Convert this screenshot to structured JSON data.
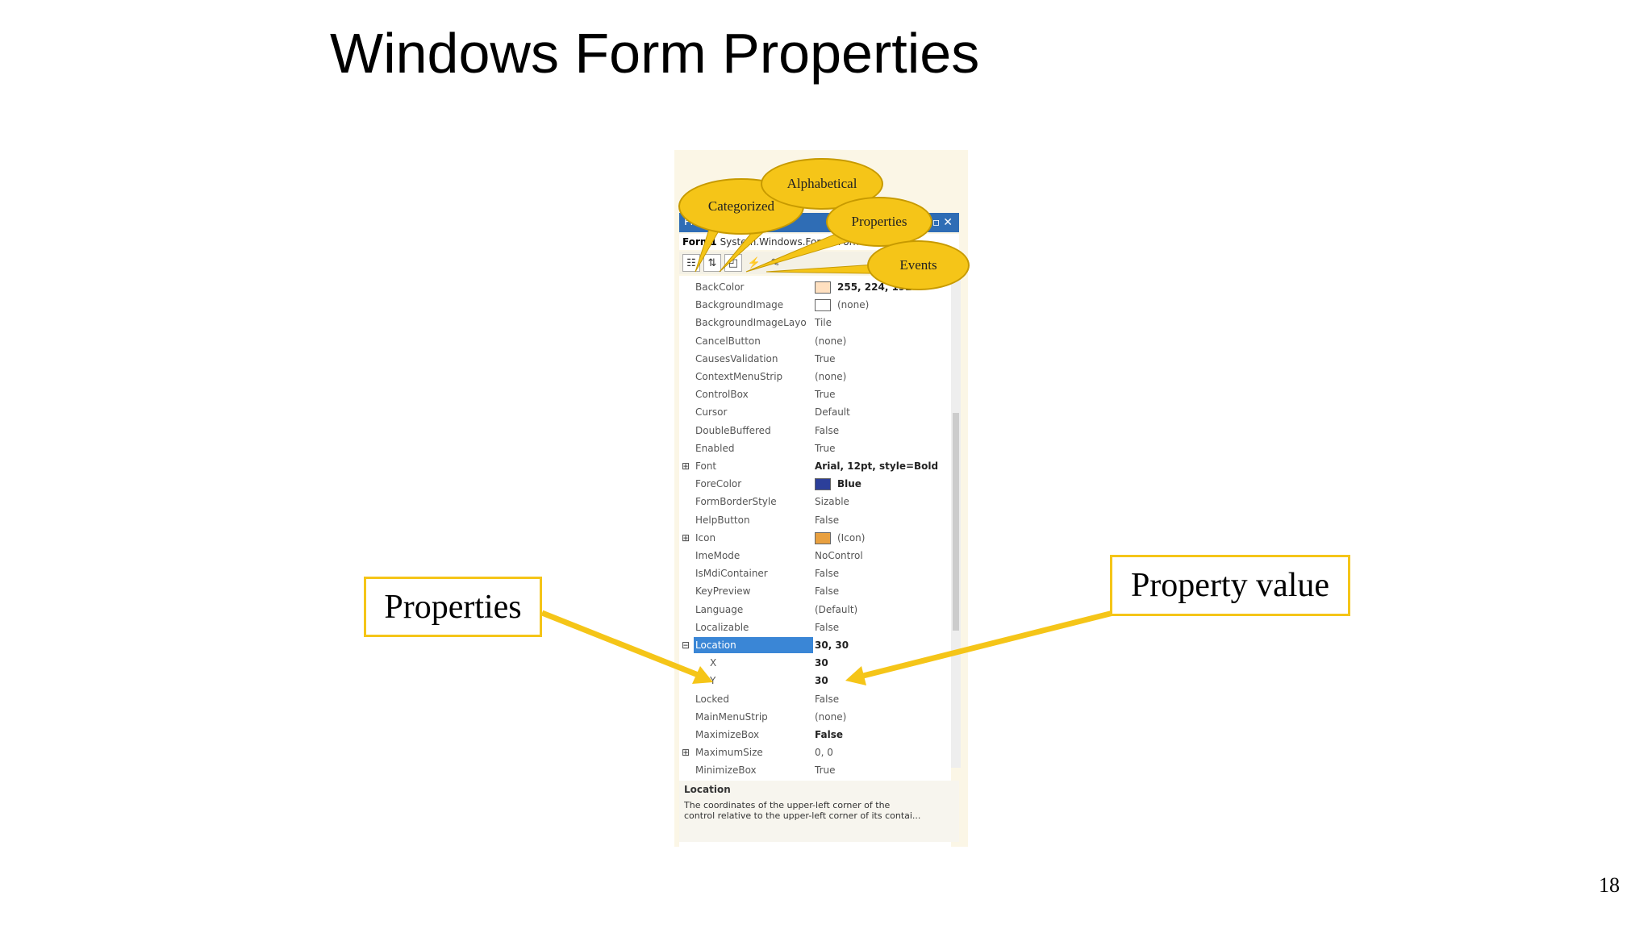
{
  "slide": {
    "title": "Windows Form Properties",
    "page_number": "18",
    "callout_properties": "Properties",
    "callout_property_value": "Property value"
  },
  "bubbles": {
    "categorized": "Categorized",
    "alphabetical": "Alphabetical",
    "properties": "Properties",
    "events": "Events"
  },
  "window": {
    "title": "Properties",
    "object_name": "Form1",
    "object_type": "System.Windows.Forms.Form"
  },
  "colors": {
    "callout_yellow": "#f5c518",
    "selection_blue": "#3a86d6",
    "backcolor_swatch": "#ffe0c0",
    "forecolor_swatch": "#2c3f9a"
  },
  "properties": [
    {
      "name": "BackColor",
      "value": "255, 224, 192",
      "swatch": "#ffe0c0",
      "bold": true
    },
    {
      "name": "BackgroundImage",
      "value": "(none)",
      "swatch": "#ffffff"
    },
    {
      "name": "BackgroundImageLayo",
      "value": "Tile"
    },
    {
      "name": "CancelButton",
      "value": "(none)"
    },
    {
      "name": "CausesValidation",
      "value": "True"
    },
    {
      "name": "ContextMenuStrip",
      "value": "(none)"
    },
    {
      "name": "ControlBox",
      "value": "True"
    },
    {
      "name": "Cursor",
      "value": "Default"
    },
    {
      "name": "DoubleBuffered",
      "value": "False"
    },
    {
      "name": "Enabled",
      "value": "True"
    },
    {
      "name": "Font",
      "value": "Arial, 12pt, style=Bold",
      "expand": "⊞",
      "bold": true
    },
    {
      "name": "ForeColor",
      "value": "Blue",
      "swatch": "#2c3f9a",
      "bold": true
    },
    {
      "name": "FormBorderStyle",
      "value": "Sizable"
    },
    {
      "name": "HelpButton",
      "value": "False"
    },
    {
      "name": "Icon",
      "value": "(Icon)",
      "expand": "⊞",
      "swatch": "#e8a040"
    },
    {
      "name": "ImeMode",
      "value": "NoControl"
    },
    {
      "name": "IsMdiContainer",
      "value": "False"
    },
    {
      "name": "KeyPreview",
      "value": "False"
    },
    {
      "name": "Language",
      "value": "(Default)"
    },
    {
      "name": "Localizable",
      "value": "False"
    },
    {
      "name": "Location",
      "value": "30, 30",
      "expand": "⊟",
      "selected": true,
      "bold": true
    },
    {
      "name": "X",
      "value": "30",
      "sub": true,
      "bold": true
    },
    {
      "name": "Y",
      "value": "30",
      "sub": true,
      "bold": true
    },
    {
      "name": "Locked",
      "value": "False"
    },
    {
      "name": "MainMenuStrip",
      "value": "(none)"
    },
    {
      "name": "MaximizeBox",
      "value": "False",
      "bold": true
    },
    {
      "name": "MaximumSize",
      "value": "0, 0",
      "expand": "⊞"
    },
    {
      "name": "MinimizeBox",
      "value": "True"
    }
  ],
  "description": {
    "title": "Location",
    "line1": "The coordinates of the upper-left corner of the",
    "line2": "control relative to the upper-left corner of its contai..."
  }
}
